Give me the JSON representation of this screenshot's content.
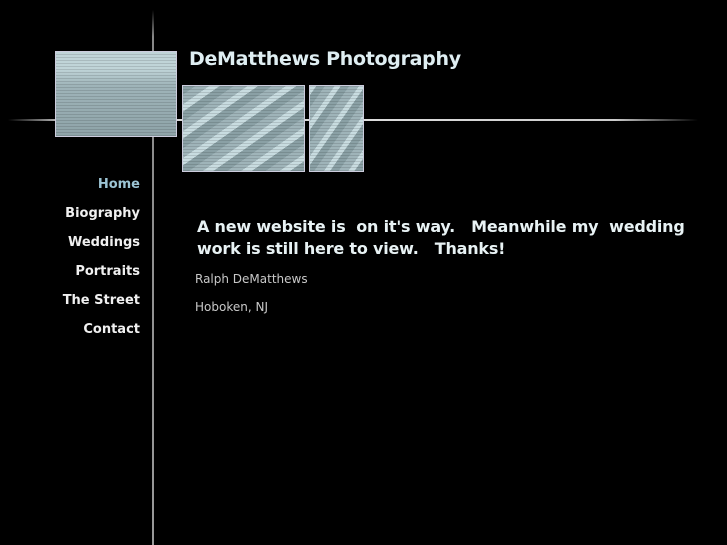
{
  "site": {
    "title": "DeMatthews Photography"
  },
  "nav": {
    "items": [
      {
        "label": "Home",
        "active": true
      },
      {
        "label": "Biography"
      },
      {
        "label": "Weddings"
      },
      {
        "label": "Portraits"
      },
      {
        "label": "The Street"
      },
      {
        "label": "Contact"
      }
    ]
  },
  "main": {
    "headline": "A new website is  on it's way.   Meanwhile my  wedding work is still here to view.   Thanks!",
    "name": "Ralph DeMatthews",
    "location": "Hoboken, NJ"
  },
  "colors": {
    "background": "#000000",
    "nav_active": "#9cc4d4",
    "text": "#f0f0f0"
  }
}
